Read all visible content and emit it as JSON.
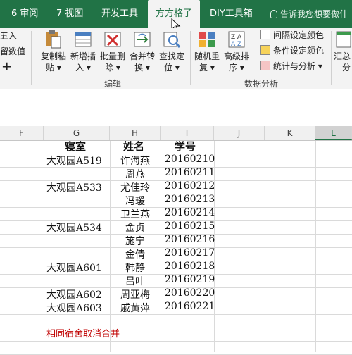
{
  "tabs": [
    {
      "label": "6 审阅",
      "active": false
    },
    {
      "label": "7 视图",
      "active": false
    },
    {
      "label": "开发工具",
      "active": false
    },
    {
      "label": "方方格子",
      "active": true
    },
    {
      "label": "DIY工具箱",
      "active": false
    }
  ],
  "tell_me": "告诉我您想要做什",
  "ribbon": {
    "left_fragments": [
      "五入",
      "留数值"
    ],
    "plus": "+",
    "edit_buttons": [
      {
        "l1": "复制粘",
        "l2": "贴 ▾"
      },
      {
        "l1": "新增插",
        "l2": "入 ▾"
      },
      {
        "l1": "批量删",
        "l2": "除 ▾"
      },
      {
        "l1": "合并转",
        "l2": "换 ▾"
      },
      {
        "l1": "查找定",
        "l2": "位 ▾"
      }
    ],
    "edit_group_label": "编辑",
    "analysis_buttons": [
      {
        "l1": "随机重",
        "l2": "复 ▾"
      },
      {
        "l1": "高级排",
        "l2": "序 ▾"
      }
    ],
    "analysis_small": [
      "间隔设定颜色",
      "条件设定颜色",
      "统计与分析 ▾"
    ],
    "analysis_group_label": "数据分析",
    "right_fragments": {
      "l1": "汇总",
      "l2": "分"
    }
  },
  "columns": [
    "F",
    "G",
    "H",
    "I",
    "J",
    "K",
    "L"
  ],
  "table": {
    "headers": [
      "寝室",
      "姓名",
      "学号"
    ],
    "rows": [
      {
        "dorm": "大观园A519",
        "name": "许海燕",
        "id": "20160210"
      },
      {
        "dorm": "",
        "name": "周燕",
        "id": "20160211"
      },
      {
        "dorm": "大观园A533",
        "name": "尤佳玲",
        "id": "20160212"
      },
      {
        "dorm": "",
        "name": "冯瑗",
        "id": "20160213"
      },
      {
        "dorm": "",
        "name": "卫兰燕",
        "id": "20160214"
      },
      {
        "dorm": "大观园A534",
        "name": "金贞",
        "id": "20160215"
      },
      {
        "dorm": "",
        "name": "施宁",
        "id": "20160216"
      },
      {
        "dorm": "",
        "name": "金倩",
        "id": "20160217"
      },
      {
        "dorm": "大观园A601",
        "name": "韩静",
        "id": "20160218"
      },
      {
        "dorm": "",
        "name": "吕叶",
        "id": "20160219"
      },
      {
        "dorm": "大观园A602",
        "name": "周亚梅",
        "id": "20160220"
      },
      {
        "dorm": "大观园A603",
        "name": "戚黄萍",
        "id": "20160221"
      }
    ]
  },
  "note": "相同宿舍取消合并",
  "colors": {
    "accent": "#217346",
    "note": "#c00000"
  }
}
